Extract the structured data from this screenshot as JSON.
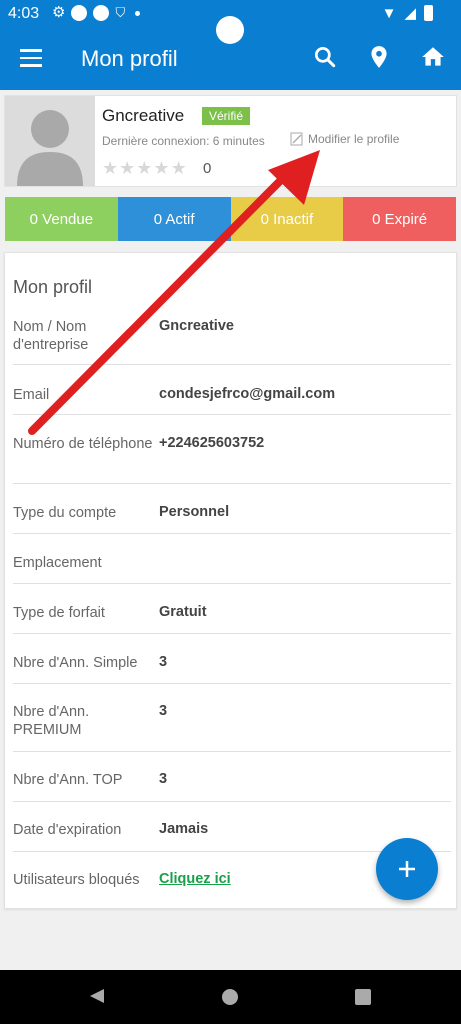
{
  "status_bar": {
    "time": "4:03"
  },
  "appbar": {
    "title": "Mon profil",
    "icons": [
      "menu-icon",
      "search-icon",
      "location-pin-icon",
      "home-icon"
    ]
  },
  "profile": {
    "name": "Gncreative",
    "badge": "Vérifié",
    "last_login": "Dernière connexion: 6 minutes",
    "edit_label": "Modifier le profile",
    "rating": "0"
  },
  "stats": [
    {
      "label": "0 Vendue",
      "color": "#8ed05f"
    },
    {
      "label": "0 Actif",
      "color": "#2e90d8"
    },
    {
      "label": "0 Inactif",
      "color": "#e8cc48"
    },
    {
      "label": "0 Expiré",
      "color": "#ef5f5f"
    }
  ],
  "info": {
    "title": "Mon profil",
    "rows": [
      {
        "label": "Nom / Nom d'entreprise",
        "value": "Gncreative"
      },
      {
        "label": "Email",
        "value": "condesjefrco@gmail.com"
      },
      {
        "label": "Numéro de téléphone",
        "value": "+224625603752"
      },
      {
        "label": "Type du compte",
        "value": "Personnel"
      },
      {
        "label": "Emplacement",
        "value": ""
      },
      {
        "label": "Type de forfait",
        "value": "Gratuit"
      },
      {
        "label": "Nbre d'Ann. Simple",
        "value": "3"
      },
      {
        "label": "Nbre d'Ann. PREMIUM",
        "value": "3"
      },
      {
        "label": "Nbre d'Ann. TOP",
        "value": "3"
      },
      {
        "label": "Date d'expiration",
        "value": "Jamais"
      },
      {
        "label": "Utilisateurs bloqués",
        "value": "Cliquez ici"
      }
    ]
  },
  "colors": {
    "primary": "#0a7fd1",
    "verified": "#7cc04a",
    "link": "#1aa04a",
    "annotation_arrow": "#e02020"
  }
}
